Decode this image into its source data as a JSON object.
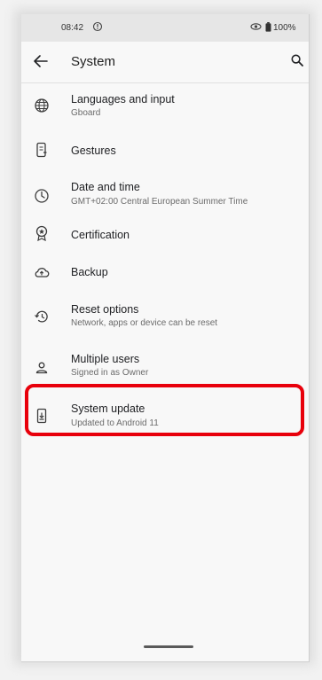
{
  "status_bar": {
    "time": "08:42",
    "battery": "100%"
  },
  "app_bar": {
    "title": "System"
  },
  "settings": [
    {
      "title": "Languages and input",
      "subtitle": "Gboard",
      "icon": "globe-icon"
    },
    {
      "title": "Gestures",
      "subtitle": "",
      "icon": "gesture-phone-icon"
    },
    {
      "title": "Date and time",
      "subtitle": "GMT+02:00 Central European Summer Time",
      "icon": "clock-icon"
    },
    {
      "title": "Certification",
      "subtitle": "",
      "icon": "badge-icon"
    },
    {
      "title": "Backup",
      "subtitle": "",
      "icon": "cloud-upload-icon"
    },
    {
      "title": "Reset options",
      "subtitle": "Network, apps or device can be reset",
      "icon": "history-icon"
    },
    {
      "title": "Multiple users",
      "subtitle": "Signed in as Owner",
      "icon": "person-icon"
    },
    {
      "title": "System update",
      "subtitle": "Updated to Android 11",
      "icon": "system-update-icon"
    }
  ],
  "highlight_color": "#e8000b"
}
